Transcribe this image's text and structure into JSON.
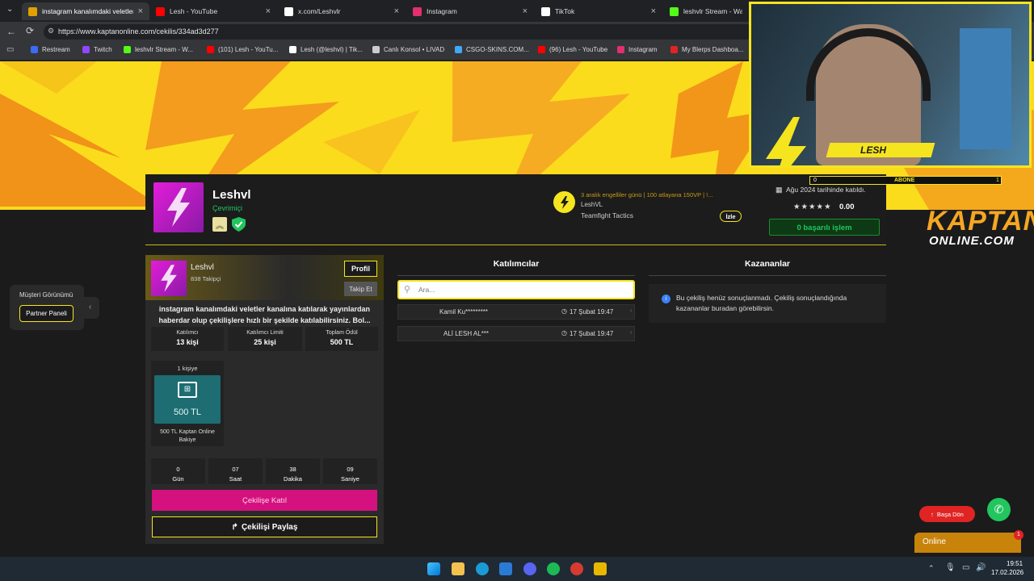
{
  "browser": {
    "tabs": [
      {
        "label": "instagram kanalımdaki veletler kan",
        "active": true,
        "icon": "kaptan-k-icon",
        "color": "#e0a000"
      },
      {
        "label": "Lesh - YouTube",
        "active": false,
        "icon": "youtube-icon",
        "color": "#ff0000"
      },
      {
        "label": "x.com/Leshvlr",
        "active": false,
        "icon": "x-icon",
        "color": "#ffffff"
      },
      {
        "label": "Instagram",
        "active": false,
        "icon": "instagram-icon",
        "color": "#e1306c"
      },
      {
        "label": "TikTok",
        "active": false,
        "icon": "tiktok-icon",
        "color": "#ffffff"
      },
      {
        "label": "leshvlr Stream - Watch",
        "active": false,
        "icon": "kick-icon",
        "color": "#53fc18"
      }
    ],
    "url": "https://www.kaptanonline.com/cekilis/334ad3d277",
    "bookmarks": [
      {
        "label": "Restream",
        "color": "#3b6cf5"
      },
      {
        "label": "Twitch",
        "color": "#9146ff"
      },
      {
        "label": "leshvlr Stream - W...",
        "color": "#53fc18"
      },
      {
        "label": "(101) Lesh - YouTu...",
        "color": "#ff0000"
      },
      {
        "label": "Lesh (@leshvl) | Tik...",
        "color": "#ffffff"
      },
      {
        "label": "Canlı Konsol • LIVAD",
        "color": "#cccccc"
      },
      {
        "label": "CSGO-SKINS.COM...",
        "color": "#3fa9f5"
      },
      {
        "label": "(96) Lesh - YouTube",
        "color": "#ff0000"
      },
      {
        "label": "Instagram",
        "color": "#e1306c"
      },
      {
        "label": "My Blerps Dashboa...",
        "color": "#e02424"
      }
    ]
  },
  "profile": {
    "name": "Leshvl",
    "status": "Çevrimiçi",
    "stream_title": "3 aralık engelliler günü | 100 atlayana 150VP | !...",
    "stream_user": "LeshVL",
    "stream_game": "Teamfight Tactics",
    "watch_label": "İzle",
    "joined": "Ağu 2024 tarihinde katıldı.",
    "rating": "0.00",
    "success_label": "0 başarılı işlem"
  },
  "webcam": {
    "name": "LESH",
    "sub_label": "ABONE",
    "sub_left": "0",
    "sub_right": "1"
  },
  "sidebar": {
    "customer_view": "Müşteri Görünümü",
    "partner_panel": "Partner Paneli"
  },
  "giveaway": {
    "owner": "Leshvl",
    "followers": "838 Takipçi",
    "profile_btn": "Profil",
    "follow_btn": "Takip Et",
    "description": "instagram kanalımdaki veletler kanalına katılarak yayınlardan haberdar olup çekilişlere hızlı bir şekilde katılabilirsiniz. Bol...",
    "stats": [
      {
        "label": "Katılımcı",
        "value": "13 kişi"
      },
      {
        "label": "Katılımcı Limiti",
        "value": "25 kişi"
      },
      {
        "label": "Toplam Ödül",
        "value": "500 TL"
      }
    ],
    "prize": {
      "count": "1 kişiye",
      "amount": "500 TL",
      "name": "500 TL Kaptan Online Bakiye"
    },
    "countdown": [
      {
        "value": "0",
        "unit": "Gün"
      },
      {
        "value": "07",
        "unit": "Saat"
      },
      {
        "value": "38",
        "unit": "Dakika"
      },
      {
        "value": "09",
        "unit": "Saniye"
      }
    ],
    "join_btn": "Çekilişe Katıl",
    "share_btn": "Çekilişi Paylaş"
  },
  "participants": {
    "title": "Katılımcılar",
    "search_placeholder": "Ara...",
    "rows": [
      {
        "name": "Kamil Ku*********",
        "time": "17 Şubat 19:47"
      },
      {
        "name": "ALİ LESH AL***",
        "time": "17 Şubat 19:47"
      }
    ]
  },
  "winners": {
    "title": "Kazananlar",
    "message": "Bu çekiliş henüz sonuçlanmadı. Çekiliş sonuçlandığında kazananlar buradan görebilirsin."
  },
  "brand": {
    "line1": "KAPTAN",
    "line2": "ONLINE.COM"
  },
  "floating": {
    "back_top": "Başa Dön",
    "online": "Online",
    "online_badge": "1"
  },
  "taskbar": {
    "time": "19:51",
    "date": "17.02.2026"
  },
  "colors": {
    "accent_yellow": "#f5e51f",
    "magenta": "#d4117f",
    "online_green": "#22c55e",
    "red": "#e02424"
  }
}
